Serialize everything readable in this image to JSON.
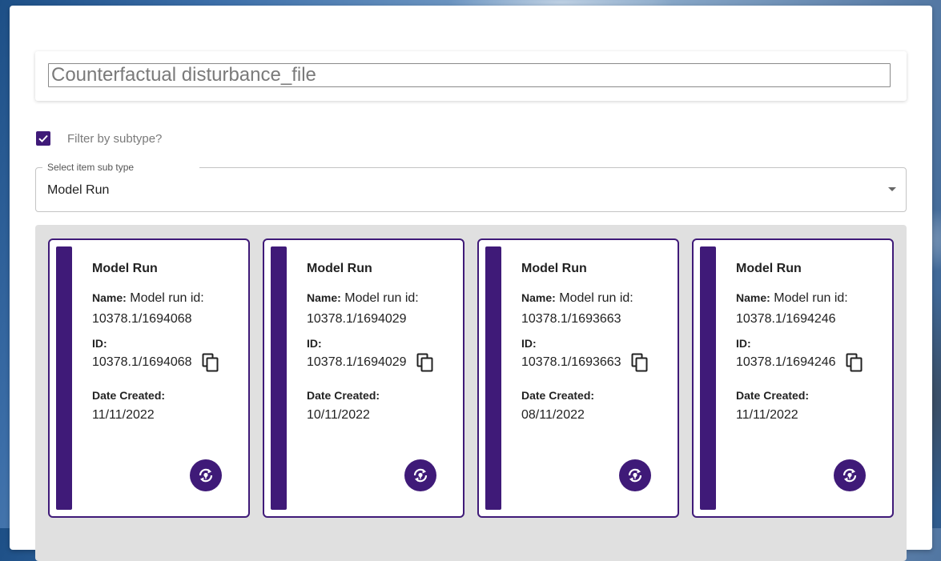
{
  "search": {
    "value": "Counterfactual disturbance_file"
  },
  "filter": {
    "label": "Filter by subtype?",
    "checked": true
  },
  "subtype_select": {
    "legend": "Select item sub type",
    "value": "Model Run"
  },
  "labels": {
    "name": "Name:",
    "id": "ID:",
    "date_created": "Date Created:"
  },
  "colors": {
    "accent": "#3f1a78",
    "results_bg": "#e0e0e0"
  },
  "cards": [
    {
      "type": "Model Run",
      "name": "Model run id: 10378.1/1694068",
      "id": "10378.1/1694068",
      "date": "11/11/2022"
    },
    {
      "type": "Model Run",
      "name": "Model run id: 10378.1/1694029",
      "id": "10378.1/1694029",
      "date": "10/11/2022"
    },
    {
      "type": "Model Run",
      "name": "Model run id: 10378.1/1693663",
      "id": "10378.1/1693663",
      "date": "08/11/2022"
    },
    {
      "type": "Model Run",
      "name": "Model run id: 10378.1/1694246",
      "id": "10378.1/1694246",
      "date": "11/11/2022"
    }
  ],
  "icons": {
    "copy": "content-copy-icon",
    "checkbox": "check-icon",
    "dropdown": "caret-down-icon",
    "action": "model-run-cycle-icon"
  }
}
